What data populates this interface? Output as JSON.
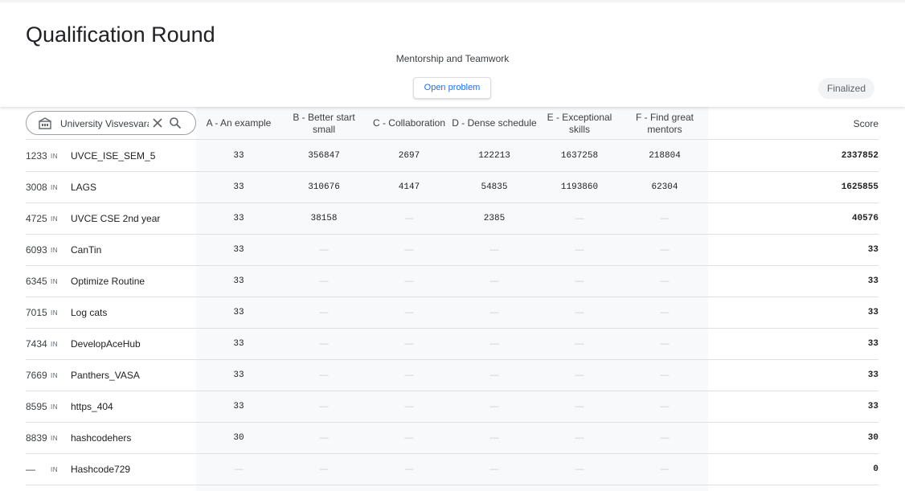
{
  "header": {
    "title": "Qualification Round",
    "subtitle": "Mentorship and Teamwork",
    "open_problem": "Open problem",
    "status": "Finalized"
  },
  "search": {
    "value": "University Visvesvaraya"
  },
  "columns": {
    "A": "A - An example",
    "B": "B - Better start small",
    "C": "C - Collaboration",
    "D": "D - Dense schedule",
    "E": "E - Exceptional skills",
    "F": "F - Find great mentors",
    "score": "Score"
  },
  "rows": [
    {
      "rank": "1233",
      "country": "IN",
      "team": "UVCE_ISE_SEM_5",
      "a": "33",
      "b": "356847",
      "c": "2697",
      "d": "122213",
      "e": "1637258",
      "f": "218804",
      "score": "2337852"
    },
    {
      "rank": "3008",
      "country": "IN",
      "team": "LAGS",
      "a": "33",
      "b": "310676",
      "c": "4147",
      "d": "54835",
      "e": "1193860",
      "f": "62304",
      "score": "1625855"
    },
    {
      "rank": "4725",
      "country": "IN",
      "team": "UVCE CSE 2nd year",
      "a": "33",
      "b": "38158",
      "c": "—",
      "d": "2385",
      "e": "—",
      "f": "—",
      "score": "40576"
    },
    {
      "rank": "6093",
      "country": "IN",
      "team": "CanTin",
      "a": "33",
      "b": "—",
      "c": "—",
      "d": "—",
      "e": "—",
      "f": "—",
      "score": "33"
    },
    {
      "rank": "6345",
      "country": "IN",
      "team": "Optimize Routine",
      "a": "33",
      "b": "—",
      "c": "—",
      "d": "—",
      "e": "—",
      "f": "—",
      "score": "33"
    },
    {
      "rank": "7015",
      "country": "IN",
      "team": "Log cats",
      "a": "33",
      "b": "—",
      "c": "—",
      "d": "—",
      "e": "—",
      "f": "—",
      "score": "33"
    },
    {
      "rank": "7434",
      "country": "IN",
      "team": "DevelopAceHub",
      "a": "33",
      "b": "—",
      "c": "—",
      "d": "—",
      "e": "—",
      "f": "—",
      "score": "33"
    },
    {
      "rank": "7669",
      "country": "IN",
      "team": "Panthers_VASA",
      "a": "33",
      "b": "—",
      "c": "—",
      "d": "—",
      "e": "—",
      "f": "—",
      "score": "33"
    },
    {
      "rank": "8595",
      "country": "IN",
      "team": "https_404",
      "a": "33",
      "b": "—",
      "c": "—",
      "d": "—",
      "e": "—",
      "f": "—",
      "score": "33"
    },
    {
      "rank": "8839",
      "country": "IN",
      "team": "hashcodehers",
      "a": "30",
      "b": "—",
      "c": "—",
      "d": "—",
      "e": "—",
      "f": "—",
      "score": "30"
    },
    {
      "rank": "—",
      "country": "IN",
      "team": "Hashcode729",
      "a": "—",
      "b": "—",
      "c": "—",
      "d": "—",
      "e": "—",
      "f": "—",
      "score": "0"
    }
  ]
}
